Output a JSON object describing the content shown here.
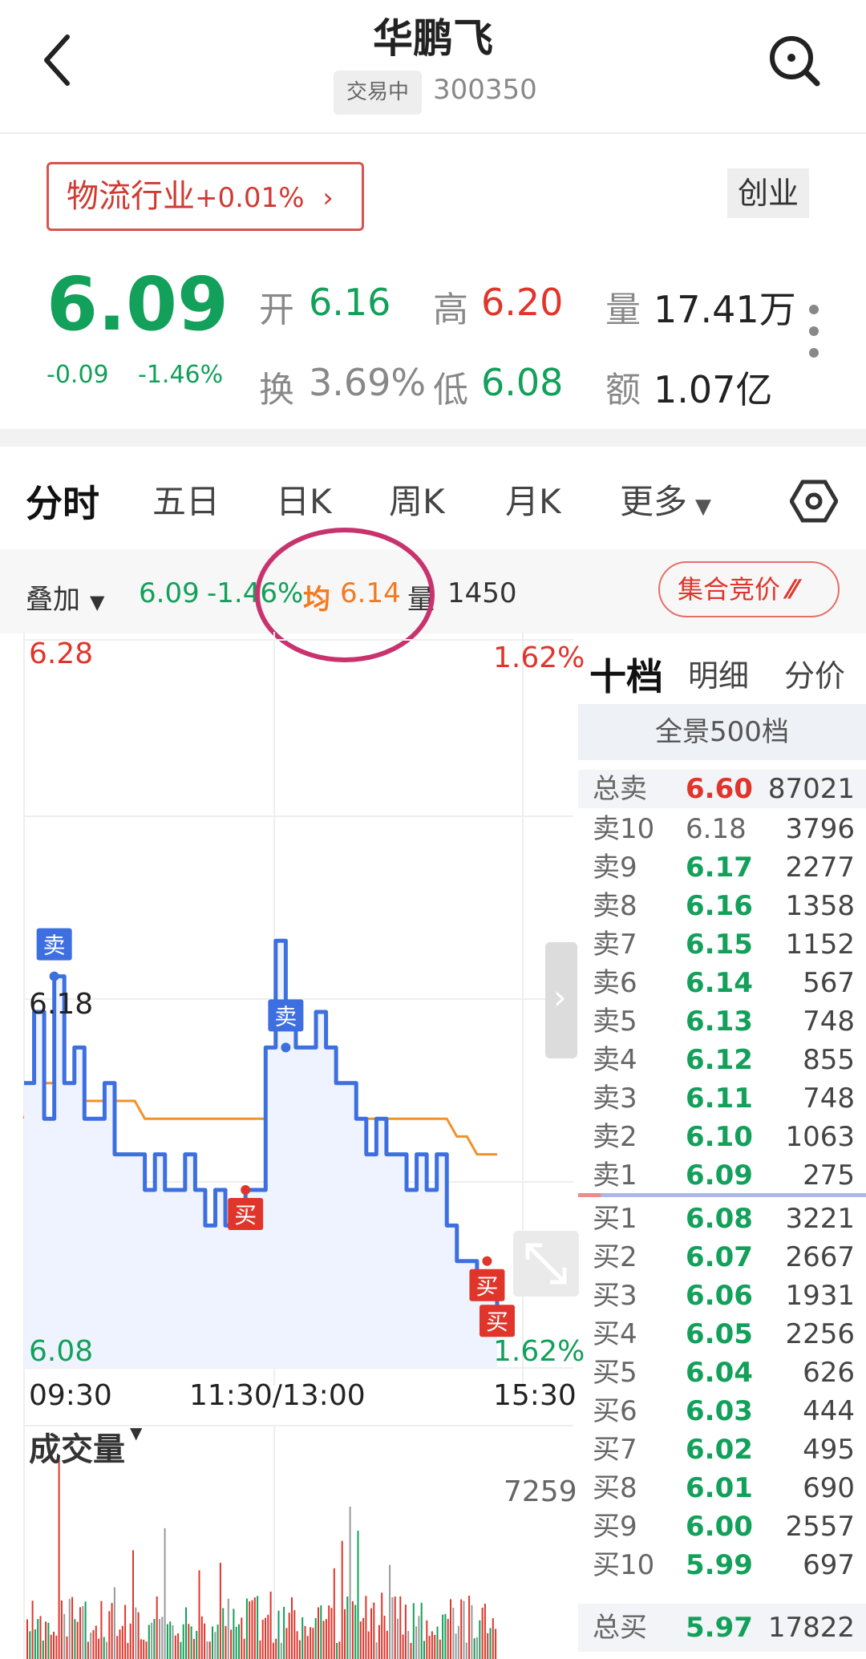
{
  "header": {
    "title": "华鹏飞",
    "status": "交易中",
    "code": "300350"
  },
  "quote": {
    "industry": "物流行业",
    "industry_chg": "+0.01%",
    "board": "创业",
    "price": "6.09",
    "chg_abs": "-0.09",
    "chg_pct": "-1.46%",
    "open_label": "开",
    "open": "6.16",
    "high_label": "高",
    "high": "6.20",
    "vol_label": "量",
    "vol": "17.41万",
    "turnover_label": "换",
    "turnover": "3.69%",
    "low_label": "低",
    "low": "6.08",
    "amount_label": "额",
    "amount": "1.07亿"
  },
  "tabs": [
    "分时",
    "五日",
    "日K",
    "周K",
    "月K",
    "更多"
  ],
  "toolbar": {
    "overlay": "叠加",
    "price": "6.09",
    "pct": "-1.46%",
    "avg_label": "均",
    "avg": "6.14",
    "vol_label": "量",
    "vol": "1450",
    "auction": "集合竞价"
  },
  "chart": {
    "y_max": "6.28",
    "y_max_pct": "1.62%",
    "y_mid": "6.18",
    "y_min": "6.08",
    "y_min_pct": "1.62%",
    "t_start": "09:30",
    "t_mid": "11:30/13:00",
    "t_end": "15:30",
    "vol_title": "成交量",
    "vol_max": "7259",
    "markers": [
      {
        "label": "卖",
        "type": "sell"
      },
      {
        "label": "卖",
        "type": "sell"
      },
      {
        "label": "买",
        "type": "buy"
      },
      {
        "label": "买",
        "type": "buy"
      },
      {
        "label": "买",
        "type": "buy"
      }
    ],
    "colors": {
      "price": "#3d6fe0",
      "avg": "#f0922c",
      "up": "#e0352b",
      "down": "#12a05a"
    }
  },
  "chart_data": {
    "type": "line",
    "title": "",
    "xlabel": "",
    "ylabel": "",
    "x_ticks": [
      "09:30",
      "11:30/13:00",
      "15:30"
    ],
    "ylim": [
      6.08,
      6.28
    ],
    "series": [
      {
        "values": [
          6.16,
          6.18,
          6.15,
          6.19,
          6.16,
          6.17,
          6.15,
          6.15,
          6.16,
          6.14,
          6.14,
          6.14,
          6.13,
          6.14,
          6.13,
          6.13,
          6.14,
          6.13,
          6.12,
          6.13,
          6.12,
          6.12,
          6.13,
          6.13,
          6.17,
          6.2,
          6.18,
          6.17,
          6.17,
          6.18,
          6.17,
          6.16,
          6.16,
          6.15,
          6.14,
          6.15,
          6.14,
          6.14,
          6.13,
          6.14,
          6.13,
          6.14,
          6.12,
          6.11,
          6.11,
          6.1,
          6.1,
          6.09
        ]
      },
      {
        "values": [
          6.15,
          6.16,
          6.16,
          6.16,
          6.16,
          6.155,
          6.155,
          6.155,
          6.155,
          6.155,
          6.155,
          6.155,
          6.15,
          6.15,
          6.15,
          6.15,
          6.15,
          6.15,
          6.15,
          6.15,
          6.15,
          6.15,
          6.15,
          6.15,
          6.15,
          6.15,
          6.15,
          6.15,
          6.15,
          6.15,
          6.15,
          6.15,
          6.15,
          6.15,
          6.15,
          6.15,
          6.15,
          6.15,
          6.15,
          6.15,
          6.15,
          6.15,
          6.15,
          6.145,
          6.145,
          6.14,
          6.14,
          6.14
        ]
      }
    ]
  },
  "orderbook": {
    "tabs": [
      "十档",
      "明细",
      "分价"
    ],
    "full_depth": "全景500档",
    "total_sell": {
      "label": "总卖",
      "price": "6.60",
      "vol": "87021"
    },
    "asks": [
      {
        "label": "卖10",
        "price": "6.18",
        "vol": "3796"
      },
      {
        "label": "卖9",
        "price": "6.17",
        "vol": "2277"
      },
      {
        "label": "卖8",
        "price": "6.16",
        "vol": "1358"
      },
      {
        "label": "卖7",
        "price": "6.15",
        "vol": "1152"
      },
      {
        "label": "卖6",
        "price": "6.14",
        "vol": "567"
      },
      {
        "label": "卖5",
        "price": "6.13",
        "vol": "748"
      },
      {
        "label": "卖4",
        "price": "6.12",
        "vol": "855"
      },
      {
        "label": "卖3",
        "price": "6.11",
        "vol": "748"
      },
      {
        "label": "卖2",
        "price": "6.10",
        "vol": "1063"
      },
      {
        "label": "卖1",
        "price": "6.09",
        "vol": "275"
      }
    ],
    "bids": [
      {
        "label": "买1",
        "price": "6.08",
        "vol": "3221"
      },
      {
        "label": "买2",
        "price": "6.07",
        "vol": "2667"
      },
      {
        "label": "买3",
        "price": "6.06",
        "vol": "1931"
      },
      {
        "label": "买4",
        "price": "6.05",
        "vol": "2256"
      },
      {
        "label": "买5",
        "price": "6.04",
        "vol": "626"
      },
      {
        "label": "买6",
        "price": "6.03",
        "vol": "444"
      },
      {
        "label": "买7",
        "price": "6.02",
        "vol": "495"
      },
      {
        "label": "买8",
        "price": "6.01",
        "vol": "690"
      },
      {
        "label": "买9",
        "price": "6.00",
        "vol": "2557"
      },
      {
        "label": "买10",
        "price": "5.99",
        "vol": "697"
      }
    ],
    "total_buy": {
      "label": "总买",
      "price": "5.97",
      "vol": "17822"
    }
  }
}
